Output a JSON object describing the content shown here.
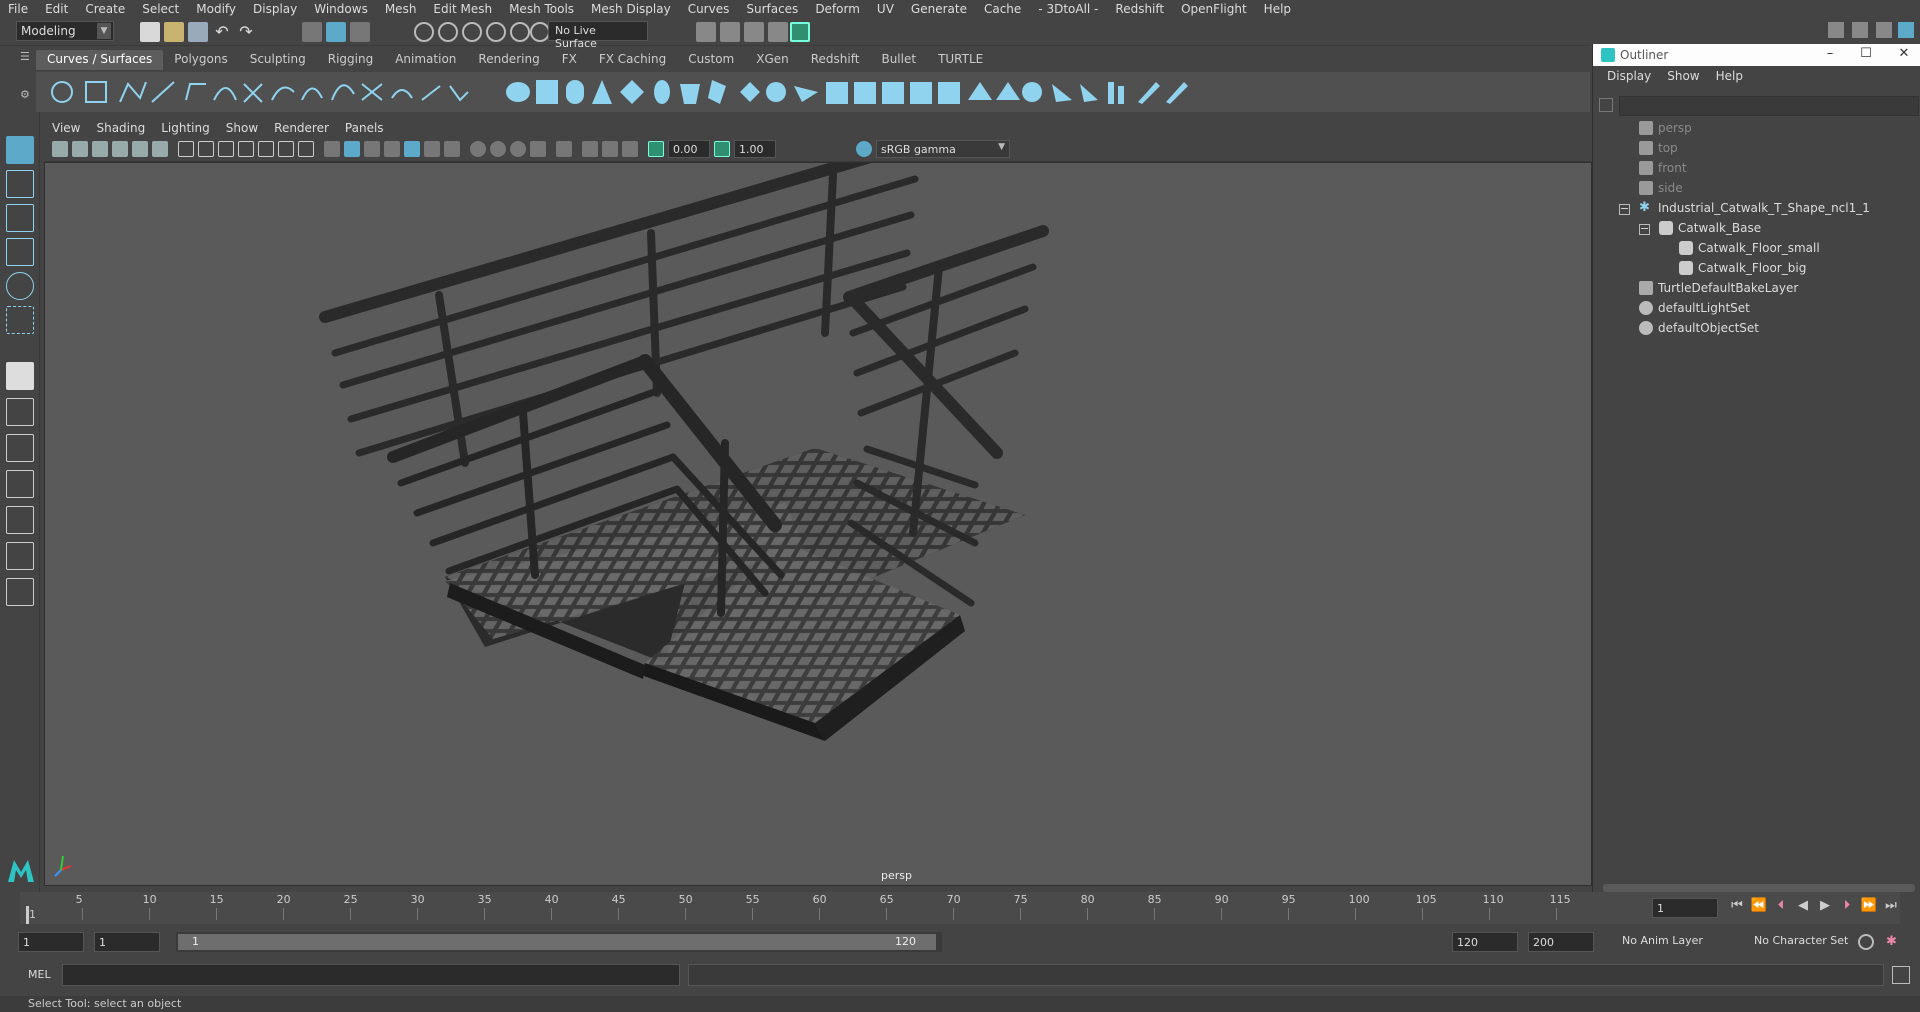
{
  "menubar": [
    "File",
    "Edit",
    "Create",
    "Select",
    "Modify",
    "Display",
    "Windows",
    "Mesh",
    "Edit Mesh",
    "Mesh Tools",
    "Mesh Display",
    "Curves",
    "Surfaces",
    "Deform",
    "UV",
    "Generate",
    "Cache",
    "- 3DtoAll -",
    "Redshift",
    "OpenFlight",
    "Help"
  ],
  "statusline": {
    "menuset": "Modeling",
    "live_surface": "No Live Surface"
  },
  "shelf": {
    "tabs": [
      "Curves / Surfaces",
      "Polygons",
      "Sculpting",
      "Rigging",
      "Animation",
      "Rendering",
      "FX",
      "FX Caching",
      "Custom",
      "XGen",
      "Redshift",
      "Bullet",
      "TURTLE"
    ],
    "active_tab": "Curves / Surfaces"
  },
  "viewport": {
    "menus": [
      "View",
      "Shading",
      "Lighting",
      "Show",
      "Renderer",
      "Panels"
    ],
    "exposure": "0.00",
    "gamma": "1.00",
    "color_space": "sRGB gamma",
    "camera_label": "persp"
  },
  "outliner": {
    "title": "Outliner",
    "menus": [
      "Display",
      "Show",
      "Help"
    ],
    "items": [
      {
        "label": "persp",
        "icon": "camera-icon",
        "dim": true
      },
      {
        "label": "top",
        "icon": "camera-icon",
        "dim": true
      },
      {
        "label": "front",
        "icon": "camera-icon",
        "dim": true
      },
      {
        "label": "side",
        "icon": "camera-icon",
        "dim": true
      },
      {
        "label": "Industrial_Catwalk_T_Shape_ncl1_1",
        "icon": "group-icon",
        "dim": false
      },
      {
        "label": "Catwalk_Base",
        "icon": "mesh-icon",
        "dim": false
      },
      {
        "label": "Catwalk_Floor_small",
        "icon": "mesh-icon",
        "dim": false
      },
      {
        "label": "Catwalk_Floor_big",
        "icon": "mesh-icon",
        "dim": false
      },
      {
        "label": "TurtleDefaultBakeLayer",
        "icon": "bake-layer-icon",
        "dim": false
      },
      {
        "label": "defaultLightSet",
        "icon": "set-icon",
        "dim": false
      },
      {
        "label": "defaultObjectSet",
        "icon": "set-icon",
        "dim": false
      }
    ]
  },
  "timeline": {
    "ticks": [
      "5",
      "10",
      "15",
      "20",
      "25",
      "30",
      "35",
      "40",
      "45",
      "50",
      "55",
      "60",
      "65",
      "70",
      "75",
      "80",
      "85",
      "90",
      "95",
      "100",
      "105",
      "110",
      "115"
    ],
    "start_marker": "1",
    "current_frame": "1"
  },
  "range": {
    "start": "1",
    "playback_start": "1",
    "slider_start": "1",
    "slider_end": "120",
    "playback_end": "120",
    "end": "200",
    "anim_layer": "No Anim Layer",
    "character_set": "No Character Set"
  },
  "cmdline": {
    "lang": "MEL"
  },
  "helpline": "Select Tool: select an object",
  "colors": {
    "accent": "#5da9c9",
    "viewport_bg": "#5a5a5a",
    "ui_bg": "#444444"
  }
}
